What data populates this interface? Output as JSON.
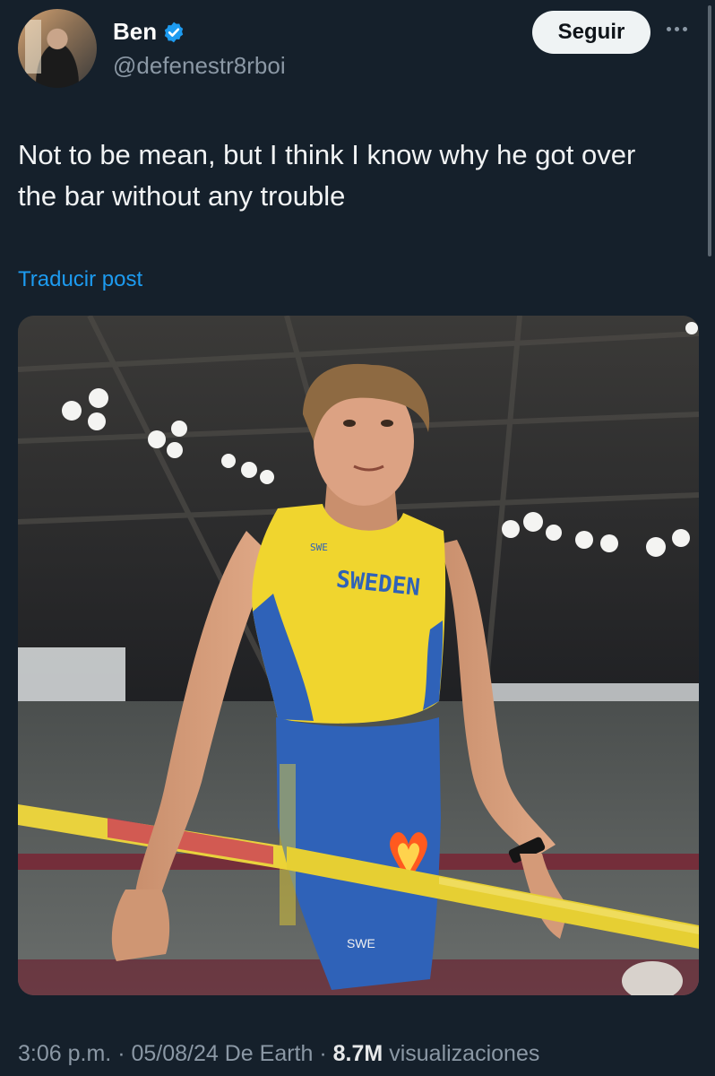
{
  "author": {
    "name": "Ben",
    "handle": "@defenestr8rboi",
    "verified": true,
    "verified_color": "#1d9bf0"
  },
  "actions": {
    "follow_label": "Seguir",
    "more_icon": "more-horizontal-icon"
  },
  "post": {
    "text": "Not to be mean, but I think I know why he got over the bar without any trouble",
    "translate_label": "Traducir post"
  },
  "media": {
    "jersey_country": "SWEDEN",
    "jersey_code": "SWE",
    "shorts_code": "SWE",
    "emoji": "heart-on-fire-emoji"
  },
  "meta": {
    "time": "3:06 p.m.",
    "date": "05/08/24",
    "source": "De Earth",
    "views": "8.7M",
    "views_label": "visualizaciones"
  },
  "colors": {
    "background": "#15202b",
    "link": "#1d9bf0",
    "secondary_text": "#8b98a5"
  }
}
